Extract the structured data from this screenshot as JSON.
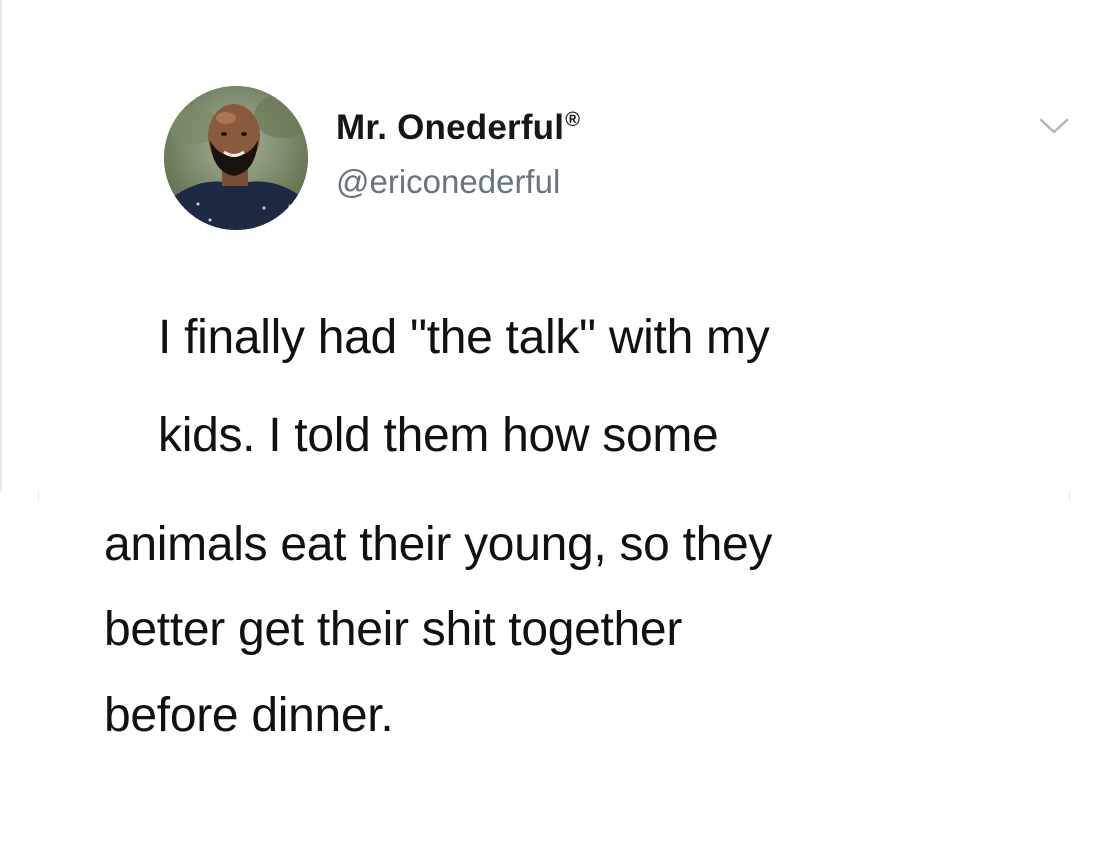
{
  "author": {
    "display_name": "Mr. Onederful",
    "registered_mark": "®",
    "handle": "@ericonederful"
  },
  "tweet": {
    "lines_top": [
      "I finally had \"the talk\" with my",
      "kids. I told them how some"
    ],
    "lines_bottom": [
      "animals eat their young, so they",
      "better get their shit together",
      "before dinner."
    ]
  },
  "icons": {
    "menu": "chevron-down-icon",
    "avatar": "profile-photo"
  },
  "colors": {
    "name": "#14171a",
    "handle": "#66757f",
    "text": "#111111",
    "chevron": "#aab8c2"
  }
}
